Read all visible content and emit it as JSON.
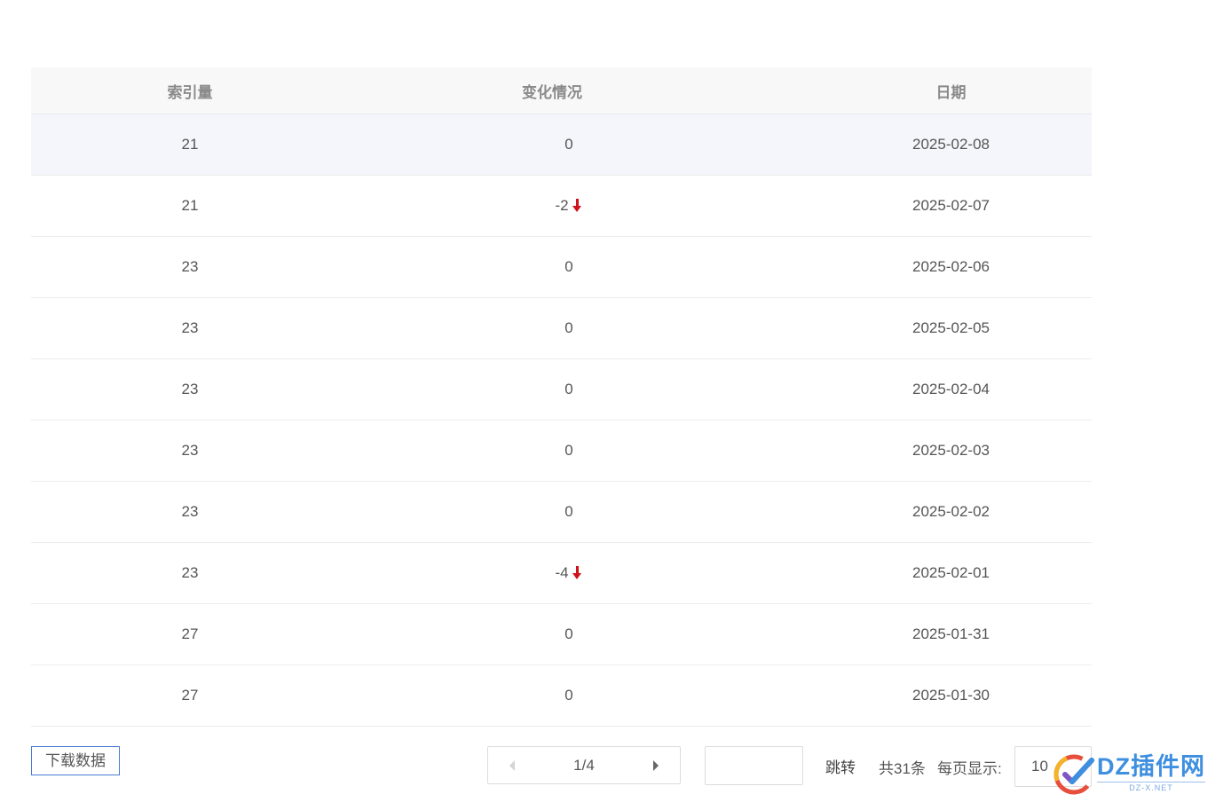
{
  "table": {
    "headers": {
      "index": "索引量",
      "change": "变化情况",
      "date": "日期"
    },
    "rows": [
      {
        "index": "21",
        "change": "0",
        "down": false,
        "date": "2025-02-08"
      },
      {
        "index": "21",
        "change": "-2",
        "down": true,
        "date": "2025-02-07"
      },
      {
        "index": "23",
        "change": "0",
        "down": false,
        "date": "2025-02-06"
      },
      {
        "index": "23",
        "change": "0",
        "down": false,
        "date": "2025-02-05"
      },
      {
        "index": "23",
        "change": "0",
        "down": false,
        "date": "2025-02-04"
      },
      {
        "index": "23",
        "change": "0",
        "down": false,
        "date": "2025-02-03"
      },
      {
        "index": "23",
        "change": "0",
        "down": false,
        "date": "2025-02-02"
      },
      {
        "index": "23",
        "change": "-4",
        "down": true,
        "date": "2025-02-01"
      },
      {
        "index": "27",
        "change": "0",
        "down": false,
        "date": "2025-01-31"
      },
      {
        "index": "27",
        "change": "0",
        "down": false,
        "date": "2025-01-30"
      }
    ]
  },
  "footer": {
    "download_label": "下载数据",
    "page_indicator": "1/4",
    "jump_label": "跳转",
    "total_label": "共31条",
    "per_page_label": "每页显示:",
    "per_page_value": "10"
  },
  "watermark": {
    "main": "DZ插件网",
    "sub": "DZ-X.NET"
  },
  "colors": {
    "down_arrow": "#d0121b",
    "button_border": "#4a7bd0",
    "highlight_row": "#f4f6fb"
  }
}
